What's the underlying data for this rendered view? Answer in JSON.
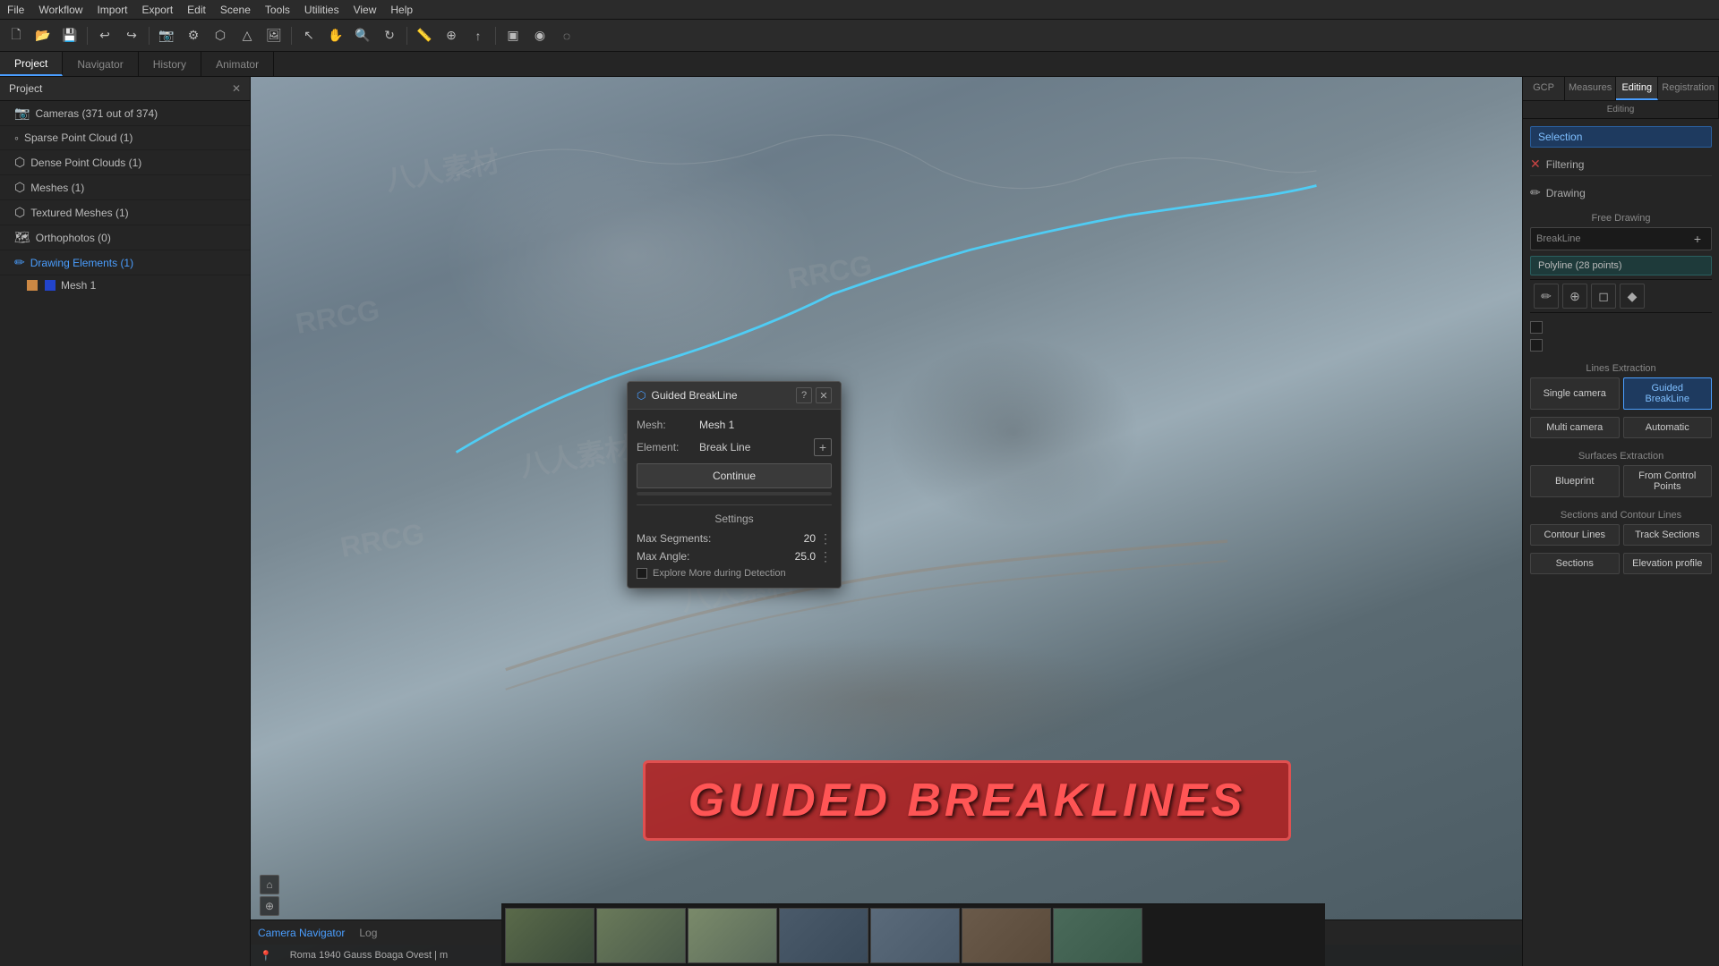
{
  "app": {
    "title": "RRCG"
  },
  "menu": {
    "items": [
      "File",
      "Workflow",
      "Import",
      "Export",
      "Edit",
      "Scene",
      "Tools",
      "Utilities",
      "View",
      "Help"
    ]
  },
  "tabs": {
    "items": [
      "Project",
      "Navigator",
      "History",
      "Animator"
    ],
    "active": "Project"
  },
  "project": {
    "header": "Project",
    "items": [
      {
        "label": "Cameras (371 out of 374)",
        "icon": "📷"
      },
      {
        "label": "Sparse Point Cloud (1)",
        "icon": "◦"
      },
      {
        "label": "Dense Point Clouds (1)",
        "icon": "⬡"
      },
      {
        "label": "Meshes (1)",
        "icon": "⬡"
      },
      {
        "label": "Textured Meshes (1)",
        "icon": "⬡"
      },
      {
        "label": "Orthophotos (0)",
        "icon": "🗺"
      },
      {
        "label": "Drawing Elements (1)",
        "icon": "✏",
        "active": true
      },
      {
        "label": "Mesh 1",
        "icon": "□",
        "sub": true
      }
    ]
  },
  "right_panel": {
    "tabs": [
      "GCP",
      "Measures",
      "Editing",
      "Registration"
    ],
    "active_tab": "Editing",
    "subtabs": [
      "Editing"
    ],
    "selection_label": "Selection",
    "filtering_label": "Filtering",
    "drawing_label": "Drawing",
    "free_drawing_label": "Free Drawing",
    "breakline_placeholder": "BreakLine",
    "polyline_label": "Polyline (28 points)",
    "icon_buttons": [
      "✏",
      "⊕",
      "✎",
      "✦"
    ],
    "checkboxes": [
      false,
      false
    ],
    "lines_extraction": {
      "title": "Lines Extraction",
      "single_camera": "Single camera",
      "guided_breakline": "Guided BreakLine",
      "multi_camera": "Multi camera",
      "automatic": "Automatic"
    },
    "surfaces_extraction": {
      "title": "Surfaces Extraction",
      "blueprint": "Blueprint",
      "from_control_points": "From Control Points"
    },
    "sections_contour": {
      "title": "Sections and Contour Lines",
      "contour_lines": "Contour Lines",
      "track_sections": "Track Sections",
      "sections": "Sections",
      "elevation_profile": "Elevation profile"
    }
  },
  "dialog": {
    "title": "Guided BreakLine",
    "mesh_label": "Mesh:",
    "mesh_value": "Mesh 1",
    "element_label": "Element:",
    "element_value": "Break Line",
    "continue_btn": "Continue",
    "settings_title": "Settings",
    "max_segments_label": "Max Segments:",
    "max_segments_value": "20",
    "max_angle_label": "Max Angle:",
    "max_angle_value": "25.0",
    "explore_label": "Explore More during Detection"
  },
  "banner": {
    "text": "GUIDED BREAKLINES"
  },
  "status_bar": {
    "coord": "Roma 1940 Gauss Boaga Ovest | m"
  },
  "bottom_tabs": [
    "Camera Navigator",
    "Log"
  ],
  "active_bottom_tab": "Camera Navigator"
}
